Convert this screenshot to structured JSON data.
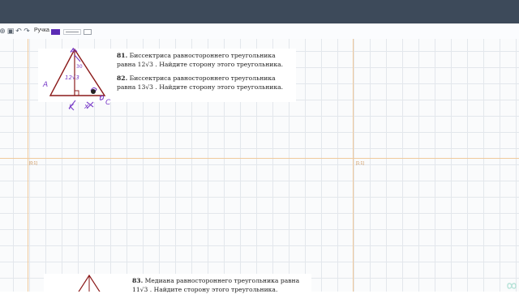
{
  "toolbar": {
    "pen_label": "Ручка",
    "pen_color": "#5b2bb5",
    "icons": [
      "drag-icon",
      "lock-icon",
      "undo-icon",
      "redo-icon"
    ]
  },
  "pages": [
    {
      "label": "[0;1]"
    },
    {
      "label": "[1;1]"
    }
  ],
  "problems": [
    {
      "num": "81.",
      "line1": "Биссектриса равностороннего треугольника",
      "line2": "равна 12√3 . Найдите сторону этого треугольника."
    },
    {
      "num": "82.",
      "line1": "Биссектриса равностороннего треугольника",
      "line2": "равна 13√3 . Найдите сторону этого треугольника."
    },
    {
      "num": "83.",
      "line1": "Медиана равностороннего треугольника равна",
      "line2": "11√3 . Найдите сторону этого треугольника."
    }
  ],
  "annotations": {
    "a_top": "A",
    "a_left": "A",
    "a_right": "C",
    "k": "K",
    "x": "x",
    "height": "12√3",
    "angle": "30"
  },
  "colors": {
    "ink": "#7b3fc9",
    "triangle": "#8b1a1a",
    "grid": "#e3e7ec",
    "page_border": "#f0c99b"
  }
}
